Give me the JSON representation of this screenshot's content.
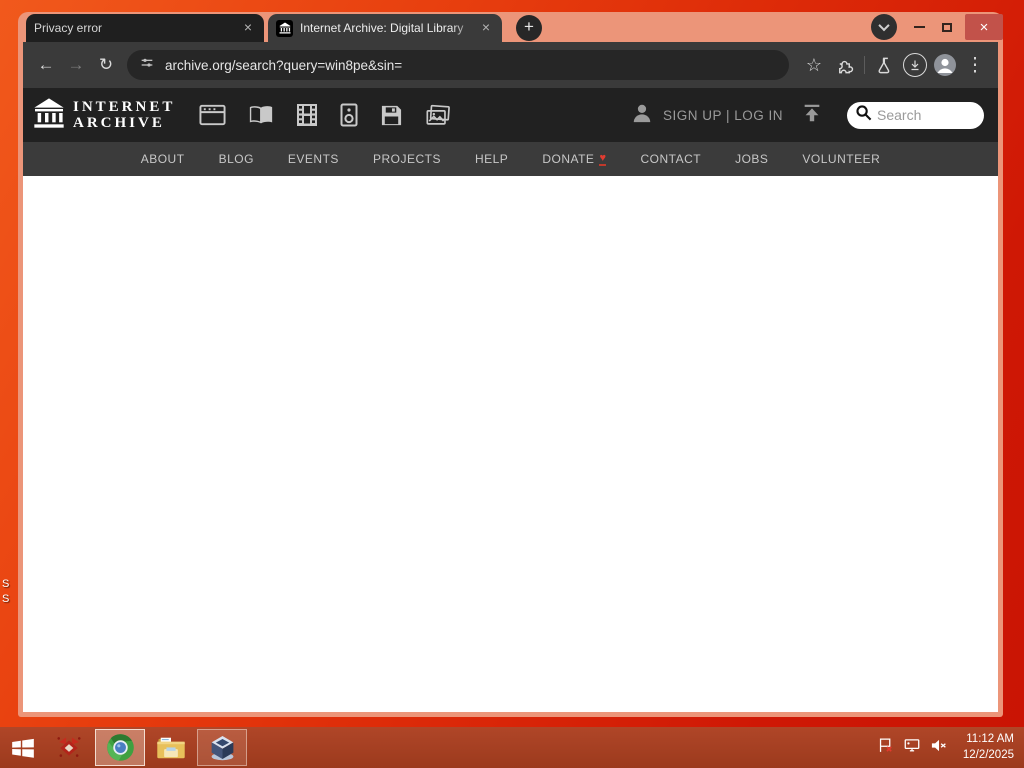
{
  "glyphs": {
    "close": "×",
    "plus": "+",
    "back": "←",
    "forward": "→",
    "reload": "↻",
    "star": "☆",
    "menu_dots": "⋮",
    "heart": "♥"
  },
  "browser": {
    "tabs": [
      {
        "title": "Privacy error"
      },
      {
        "title": "Internet Archive: Digital Library"
      }
    ],
    "url": "archive.org/search?query=win8pe&sin="
  },
  "ia": {
    "logo_line1": "INTERNET",
    "logo_line2": "ARCHIVE",
    "auth": "SIGN UP | LOG IN",
    "search_placeholder": "Search",
    "nav": [
      {
        "label": "ABOUT"
      },
      {
        "label": "BLOG"
      },
      {
        "label": "EVENTS"
      },
      {
        "label": "PROJECTS"
      },
      {
        "label": "HELP"
      },
      {
        "label": "DONATE"
      },
      {
        "label": "CONTACT"
      },
      {
        "label": "JOBS"
      },
      {
        "label": "VOLUNTEER"
      }
    ]
  },
  "desktop": {
    "label_1": "S",
    "label_2": "S"
  },
  "taskbar": {
    "time": "11:12 AM",
    "date": "12/2/2025"
  },
  "colors": {
    "desktop_orange": "#e8400f",
    "window_frame": "#ec9579",
    "toolbar_gray": "#3a3a3a",
    "close_button_red": "#c2524a",
    "donate_heart_red": "#e03c31",
    "taskbar_red": "#a84020"
  }
}
